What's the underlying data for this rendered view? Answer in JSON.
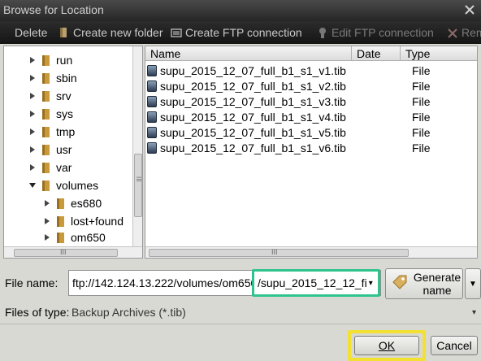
{
  "window": {
    "title": "Browse for Location"
  },
  "toolbar": {
    "delete_label": "Delete",
    "new_folder_label": "Create new folder",
    "ftp_label": "Create FTP connection",
    "edit_ftp_label": "Edit FTP connection",
    "remove_label": "Rem"
  },
  "tree": {
    "items": [
      {
        "label": "run",
        "expanded": false
      },
      {
        "label": "sbin",
        "expanded": false
      },
      {
        "label": "srv",
        "expanded": false
      },
      {
        "label": "sys",
        "expanded": false
      },
      {
        "label": "tmp",
        "expanded": false
      },
      {
        "label": "usr",
        "expanded": false
      },
      {
        "label": "var",
        "expanded": false
      },
      {
        "label": "volumes",
        "expanded": true
      },
      {
        "label": "es680",
        "expanded": false
      },
      {
        "label": "lost+found",
        "expanded": false
      },
      {
        "label": "om650",
        "expanded": false
      }
    ],
    "hscroll_marks": "III",
    "vscroll_marks": "III"
  },
  "file_list": {
    "columns": [
      "Name",
      "Date",
      "Type"
    ],
    "rows": [
      {
        "name": "supu_2015_12_07_full_b1_s1_v1.tib",
        "date": "",
        "type": "File"
      },
      {
        "name": "supu_2015_12_07_full_b1_s1_v2.tib",
        "date": "",
        "type": "File"
      },
      {
        "name": "supu_2015_12_07_full_b1_s1_v3.tib",
        "date": "",
        "type": "File"
      },
      {
        "name": "supu_2015_12_07_full_b1_s1_v4.tib",
        "date": "",
        "type": "File"
      },
      {
        "name": "supu_2015_12_07_full_b1_s1_v5.tib",
        "date": "",
        "type": "File"
      },
      {
        "name": "supu_2015_12_07_full_b1_s1_v6.tib",
        "date": "",
        "type": "File"
      }
    ],
    "hscroll_marks": "III"
  },
  "form": {
    "file_name_label": "File name:",
    "file_name_path": "ftp://142.124.13.222/volumes/om650",
    "file_name_highlight": "/supu_2015_12_12_fi",
    "generate_label": "Generate name",
    "files_of_type_label": "Files of type:",
    "files_of_type_value": "Backup Archives (*.tib)"
  },
  "buttons": {
    "ok": "OK",
    "cancel": "Cancel"
  },
  "colors": {
    "highlight_green": "#2fc48e",
    "highlight_yellow": "#f2e033",
    "folder": "#c89a3c",
    "file_icon": "#2e3d52"
  }
}
